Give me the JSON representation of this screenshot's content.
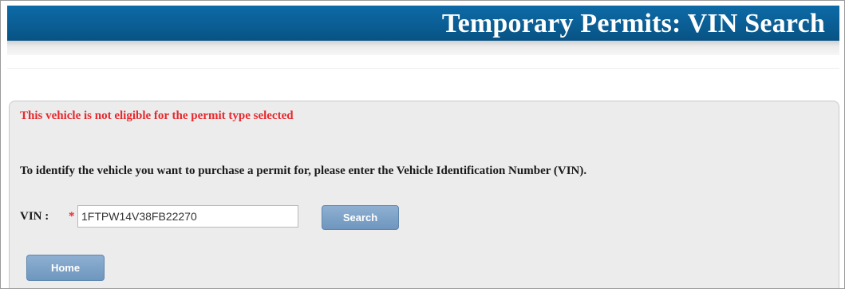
{
  "header": {
    "title": "Temporary Permits: VIN Search"
  },
  "messages": {
    "error": "This vehicle is not eligible for the permit type selected",
    "instructions": "To identify the vehicle you want to purchase a permit for, please enter the Vehicle Identification Number (VIN)."
  },
  "form": {
    "vin_label": "VIN :",
    "required_marker": "*",
    "vin_value": "1FTPW14V38FB22270",
    "search_label": "Search",
    "home_label": "Home"
  },
  "colors": {
    "header_blue": "#0a5d93",
    "error_red": "#e8282d",
    "button_blue": "#7a9fc6",
    "panel_gray": "#ececec"
  }
}
